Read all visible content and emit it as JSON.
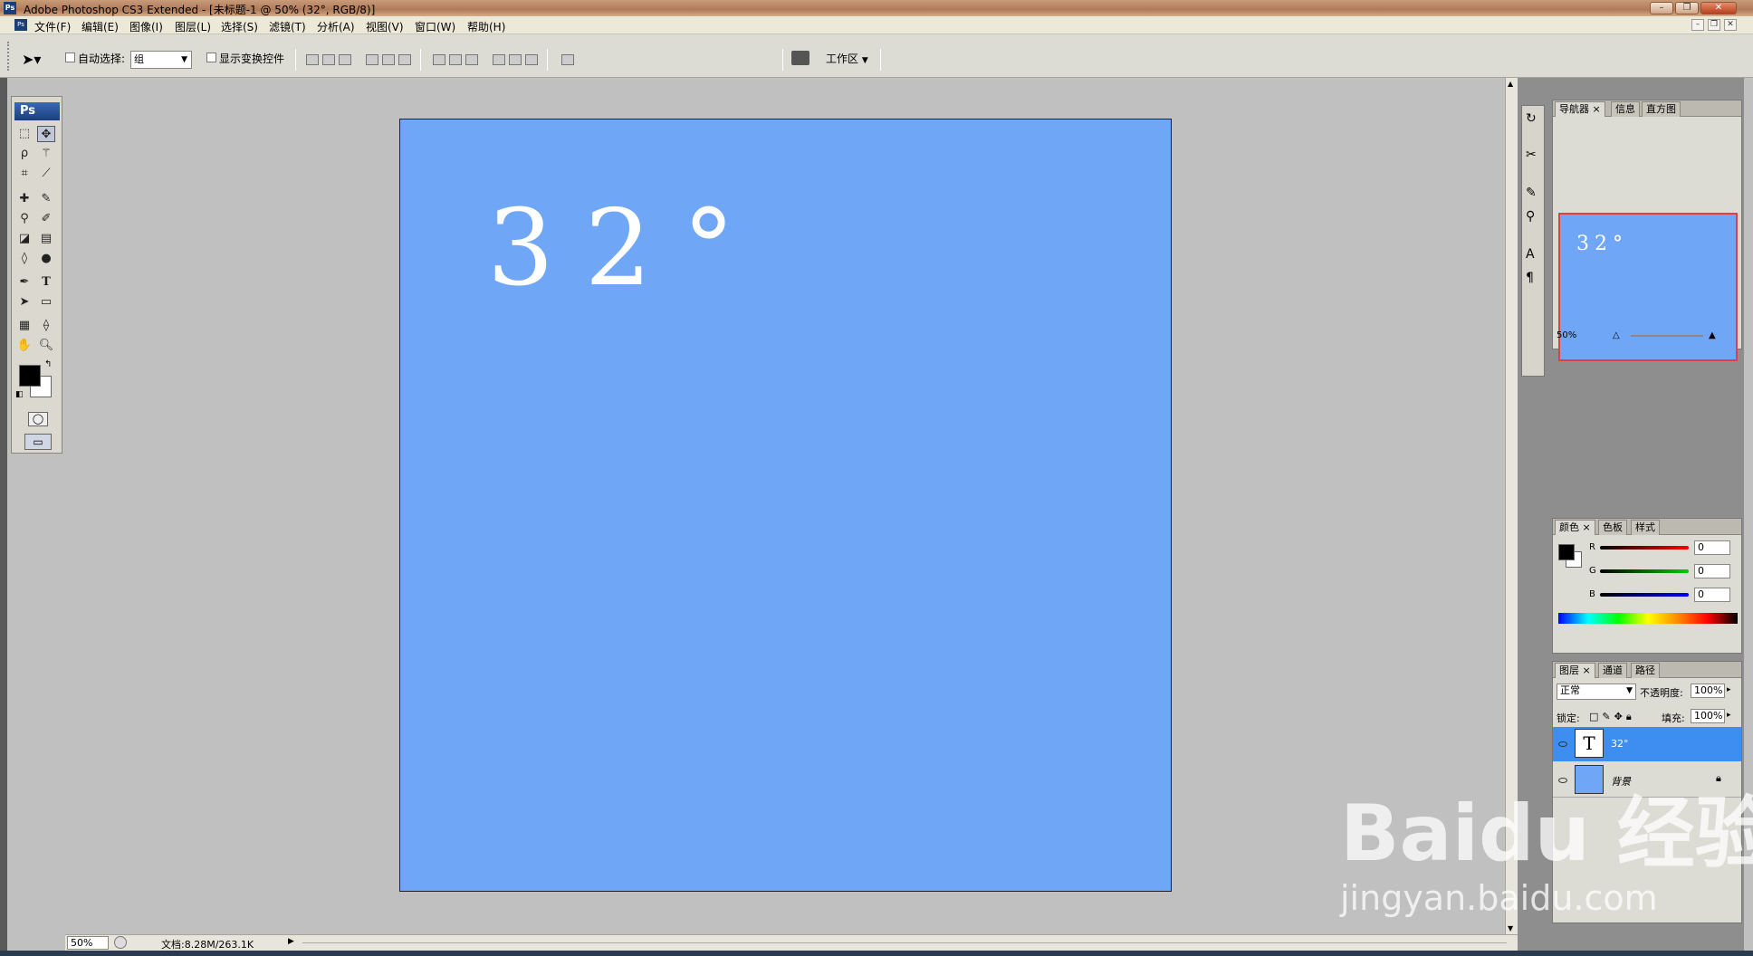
{
  "window": {
    "title": "Adobe Photoshop CS3 Extended - [未标题-1 @ 50% (32°, RGB/8)]",
    "app_icon": "Ps"
  },
  "menu": [
    "文件(F)",
    "编辑(E)",
    "图像(I)",
    "图层(L)",
    "选择(S)",
    "滤镜(T)",
    "分析(A)",
    "视图(V)",
    "窗口(W)",
    "帮助(H)"
  ],
  "options": {
    "auto_select_label": "自动选择:",
    "auto_select_value": "组",
    "show_transform_label": "显示变换控件",
    "workspace_label": "工作区"
  },
  "toolbox": {
    "logo": "Ps"
  },
  "canvas": {
    "text": "32°",
    "background_color": "#6fa6f5"
  },
  "status": {
    "zoom": "50%",
    "doc_info": "文档:8.28M/263.1K"
  },
  "navigator": {
    "tabs": [
      "导航器",
      "信息",
      "直方图"
    ],
    "preview_text": "32°",
    "zoom": "50%"
  },
  "color_panel": {
    "tabs": [
      "颜色",
      "色板",
      "样式"
    ],
    "channels": [
      {
        "label": "R",
        "value": "0"
      },
      {
        "label": "G",
        "value": "0"
      },
      {
        "label": "B",
        "value": "0"
      }
    ]
  },
  "layers_panel": {
    "tabs": [
      "图层",
      "通道",
      "路径"
    ],
    "blend_mode": "正常",
    "opacity_label": "不透明度:",
    "opacity_value": "100%",
    "lock_label": "锁定:",
    "fill_label": "填充:",
    "fill_value": "100%",
    "layers": [
      {
        "name": "32°",
        "thumb": "T",
        "selected": true
      },
      {
        "name": "背景",
        "thumb": "",
        "selected": false
      }
    ]
  },
  "watermark": {
    "line1": "Baidu 经验",
    "line2": "jingyan.baidu.com"
  },
  "colors": {
    "accent": "#3d8ef0",
    "canvas": "#6fa6f5"
  }
}
